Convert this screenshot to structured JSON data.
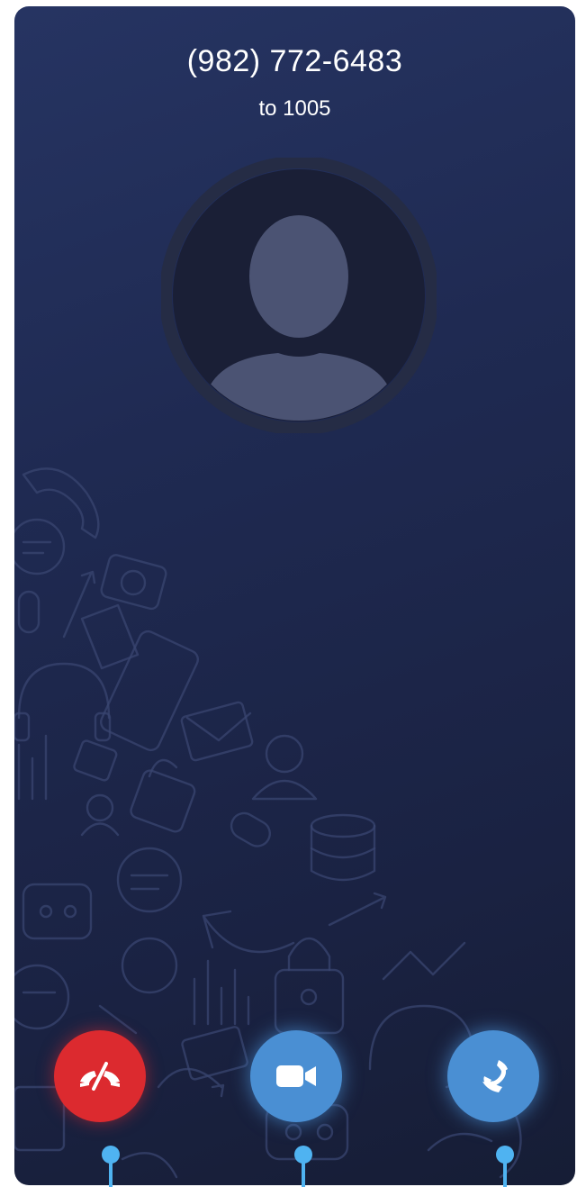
{
  "call": {
    "caller_number": "(982) 772-6483",
    "destination": "to 1005"
  },
  "avatar": {
    "icon": "person-silhouette-icon"
  },
  "actions": {
    "decline": {
      "icon": "hang-up-icon",
      "color": "#dc2a2f"
    },
    "video": {
      "icon": "video-camera-icon",
      "color": "#4a8fd3"
    },
    "answer": {
      "icon": "phone-icon",
      "color": "#4a8fd3"
    }
  },
  "colors": {
    "background": "#1f2a52",
    "pointer": "#4fb3f1"
  }
}
